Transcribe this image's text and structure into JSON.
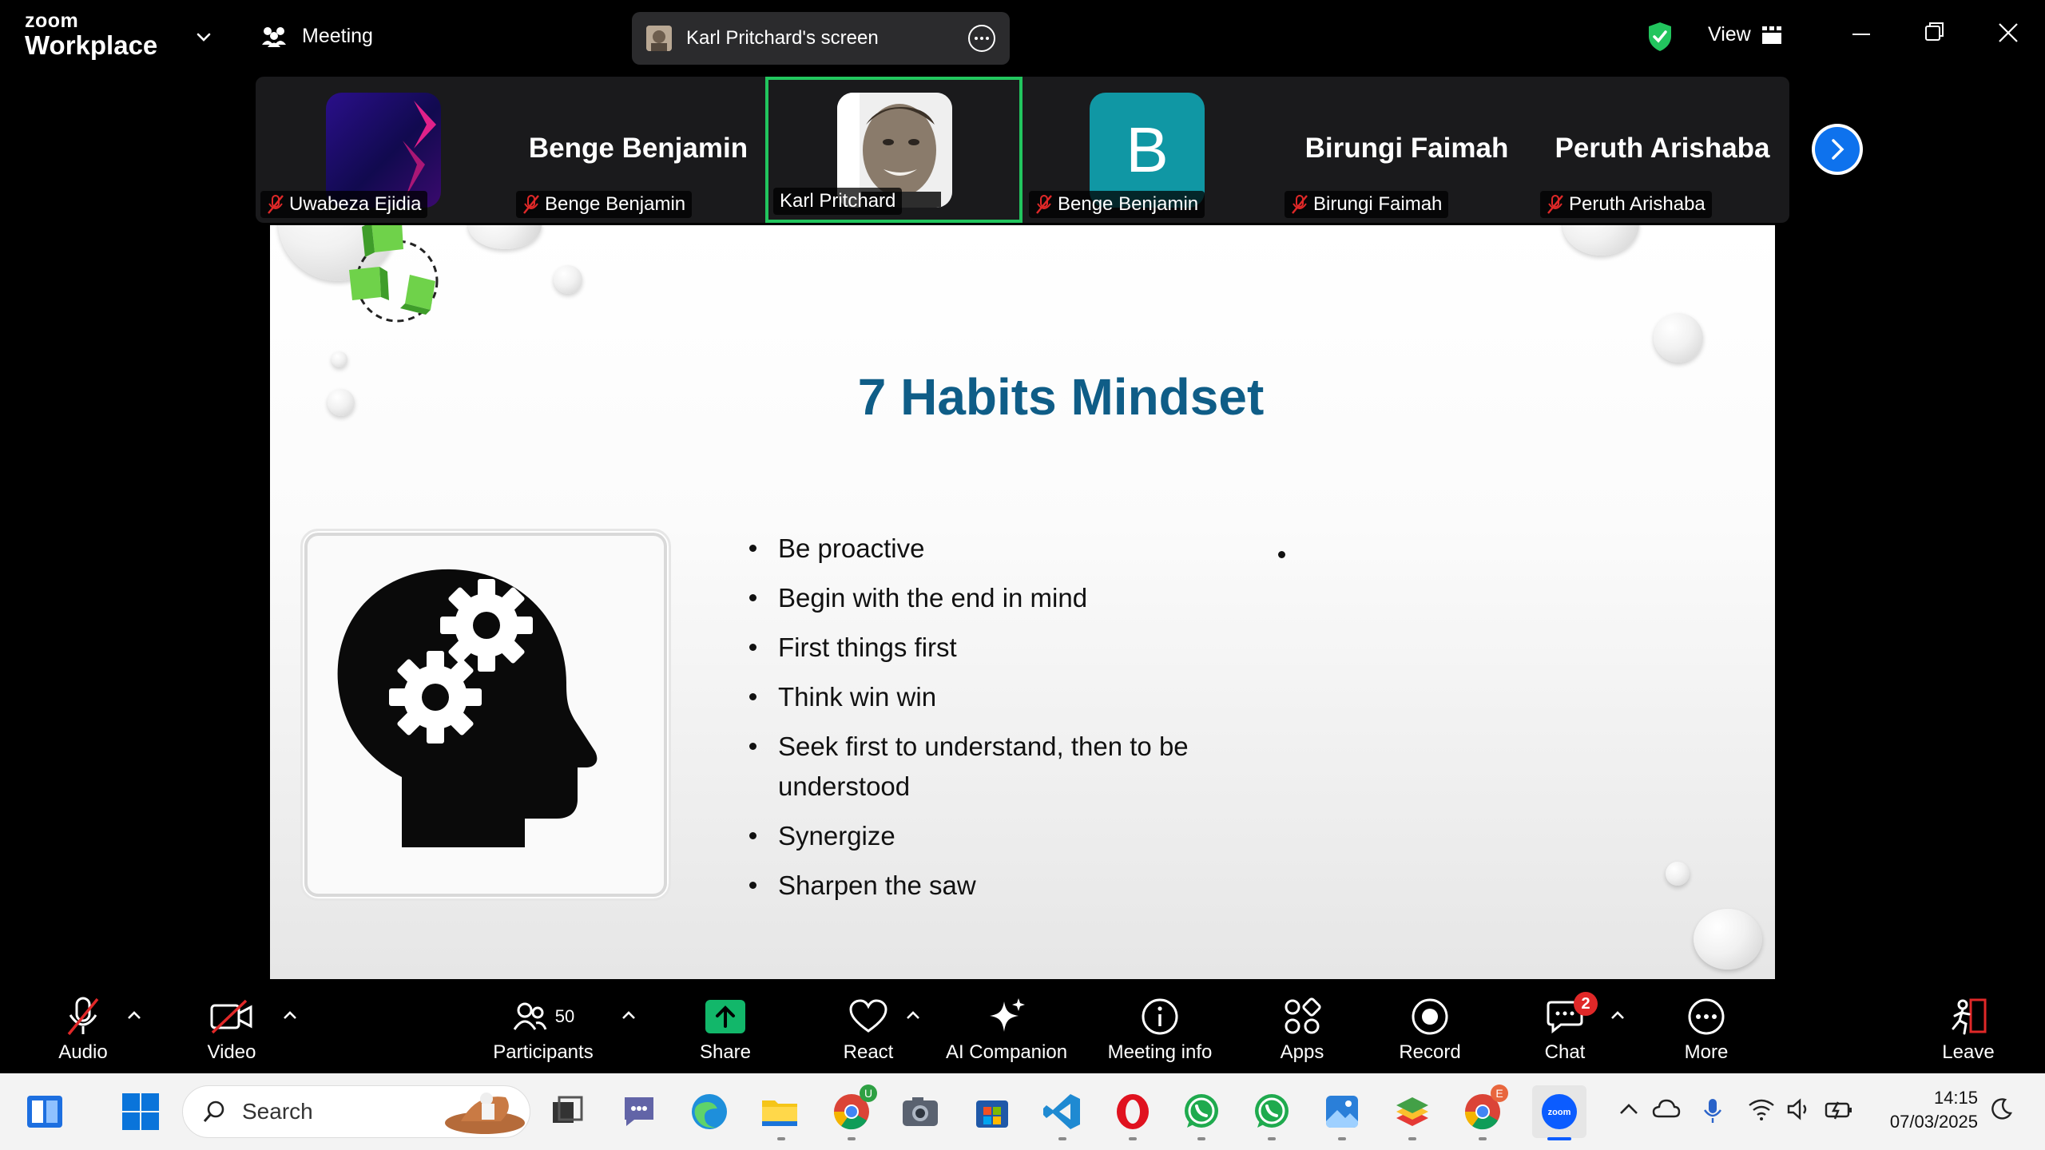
{
  "app": {
    "brand_top": "zoom",
    "brand_bottom": "Workplace"
  },
  "titlebar": {
    "meeting_label": "Meeting",
    "share_label": "Karl Pritchard's screen",
    "view_label": "View",
    "security_color": "#22c55e"
  },
  "participants_strip": [
    {
      "tile_text": "",
      "label": "Uwabeza Ejidia",
      "muted": true
    },
    {
      "tile_text": "Benge Benjamin",
      "label": "Benge Benjamin",
      "muted": true
    },
    {
      "tile_text": "",
      "label": "Karl Pritchard",
      "muted": false,
      "active_speaker": true
    },
    {
      "tile_text": "",
      "label": "Benge Benjamin",
      "muted": true,
      "avatar_letter": "B"
    },
    {
      "tile_text": "Birungi Faimah",
      "label": "Birungi Faimah",
      "muted": true
    },
    {
      "tile_text": "Peruth Arishaba",
      "label": "Peruth Arishaba",
      "muted": true
    }
  ],
  "slide": {
    "title": "7 Habits Mindset",
    "title_color": "#0f5d87",
    "bullets": [
      "Be proactive",
      "Begin with the end in mind",
      "First things first",
      "Think win win",
      "Seek first to understand, then to be understood",
      "Synergize",
      "Sharpen the saw"
    ]
  },
  "toolbar": {
    "audio": "Audio",
    "video": "Video",
    "participants": "Participants",
    "participants_count": "50",
    "share": "Share",
    "react": "React",
    "ai_companion": "AI Companion",
    "meeting_info": "Meeting info",
    "apps": "Apps",
    "record": "Record",
    "chat": "Chat",
    "chat_badge": "2",
    "more": "More",
    "leave": "Leave",
    "share_color": "#12b76a",
    "leave_color": "#e02828"
  },
  "taskbar": {
    "search_placeholder": "Search",
    "time": "14:15",
    "date": "07/03/2025",
    "badge_u": "U",
    "badge_e": "E"
  }
}
